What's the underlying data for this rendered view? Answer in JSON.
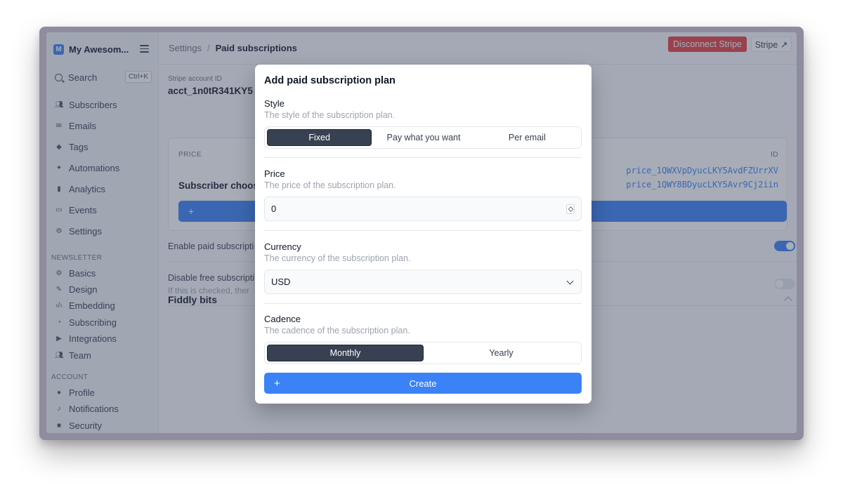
{
  "app": {
    "brand_letter": "M",
    "brand_name": "My Awesom...",
    "accent_color": "#3b82f6",
    "danger_color": "#e53e3e"
  },
  "sidebar": {
    "search": {
      "label": "Search",
      "shortcut": "Ctrl+K"
    },
    "items": [
      {
        "label": "Subscribers",
        "icon": "users-icon"
      },
      {
        "label": "Emails",
        "icon": "envelope-icon"
      },
      {
        "label": "Tags",
        "icon": "tag-icon"
      },
      {
        "label": "Automations",
        "icon": "sparkles-icon"
      },
      {
        "label": "Analytics",
        "icon": "chart-bar-icon"
      },
      {
        "label": "Events",
        "icon": "calendar-icon"
      },
      {
        "label": "Settings",
        "icon": "gear-icon"
      }
    ],
    "newsletter_section": "NEWSLETTER",
    "newsletter_items": [
      {
        "label": "Basics",
        "icon": "gear-icon"
      },
      {
        "label": "Design",
        "icon": "brush-icon"
      },
      {
        "label": "Embedding",
        "icon": "code-icon"
      },
      {
        "label": "Subscribing",
        "icon": "rss-icon"
      },
      {
        "label": "Integrations",
        "icon": "play-icon"
      },
      {
        "label": "Team",
        "icon": "users-icon"
      }
    ],
    "account_section": "ACCOUNT",
    "account_items": [
      {
        "label": "Profile",
        "icon": "user-icon"
      },
      {
        "label": "Notifications",
        "icon": "bell-icon"
      },
      {
        "label": "Security",
        "icon": "lock-icon"
      }
    ]
  },
  "topbar": {
    "breadcrumb_parent": "Settings",
    "breadcrumb_separator": "/",
    "breadcrumb_current": "Paid subscriptions",
    "disconnect_label": "Disconnect Stripe",
    "stripe_label": "Stripe ↗"
  },
  "main": {
    "account_label": "Stripe account ID",
    "account_id": "acct_1n0tR341KY5",
    "table": {
      "price_header": "PRICE",
      "id_header": "ID",
      "row_label": "Subscriber choos",
      "price_ids": [
        "price_1QWXVpDyucLKY5AvdFZUrrXV",
        "price_1QWY8BDyucLKY5Avr9Cj2iin"
      ],
      "add_symbol": "+"
    },
    "enable_label": "Enable paid subscripti",
    "enable_on": true,
    "disable_label": "Disable free subscripti",
    "disable_help": "If this is checked, ther",
    "disable_on": false,
    "fiddly_bits": "Fiddly bits"
  },
  "modal": {
    "title": "Add paid subscription plan",
    "style": {
      "label": "Style",
      "help": "The style of the subscription plan.",
      "options": [
        "Fixed",
        "Pay what you want",
        "Per email"
      ],
      "selected": "Fixed"
    },
    "price": {
      "label": "Price",
      "help": "The price of the subscription plan.",
      "value": "0"
    },
    "currency": {
      "label": "Currency",
      "help": "The currency of the subscription plan.",
      "value": "USD"
    },
    "cadence": {
      "label": "Cadence",
      "help": "The cadence of the subscription plan.",
      "options": [
        "Monthly",
        "Yearly"
      ],
      "selected": "Monthly"
    },
    "create_label": "Create",
    "create_symbol": "+"
  }
}
